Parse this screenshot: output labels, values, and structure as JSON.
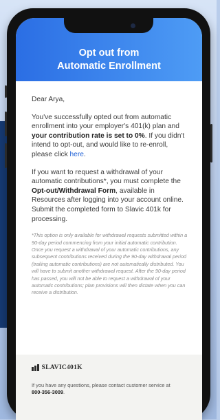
{
  "header": {
    "title_line1": "Opt out from",
    "title_line2": "Automatic Enrollment"
  },
  "email": {
    "greeting": "Dear Arya,",
    "para1_part1": "You've successfully opted out from automatic enrollment into your employer's 401(k) plan and ",
    "para1_bold": "your contribution rate is set to 0%",
    "para1_part2": ". If you didn't intend to opt-out, and would like to re-enroll, please click ",
    "para1_link": "here",
    "para1_end": ".",
    "para2_part1": "If you want to request a withdrawal of your automatic contributions*, you must complete the ",
    "para2_bold": "Opt-out/Withdrawal Form",
    "para2_part2": ", available in Resources after logging into your account online. Submit the completed form to Slavic 401k for processing.",
    "disclaimer": "*This option is only available for withdrawal requests submitted within a 90-day period commencing from your initial automatic contribution. Once you request a withdrawal of your automatic contributions, any subsequent contributions received during the 90-day withdrawal period (trailing automatic contributions) are not automatically distributed. You will have to submit another withdrawal request. After the 90-day period has passed, you will not be able to request a withdrawal of your automatic contributions; plan provisions will then dictate when you can receive a distribution."
  },
  "footer": {
    "logo_text": "SLAVIC401K",
    "contact_text": "If you have any questions, please contact customer service at",
    "phone": "800-356-3009",
    "phone_end": "."
  },
  "colors": {
    "header_start": "#2b6ee4",
    "header_end": "#4e9cf5",
    "link": "#1d5fd6"
  }
}
